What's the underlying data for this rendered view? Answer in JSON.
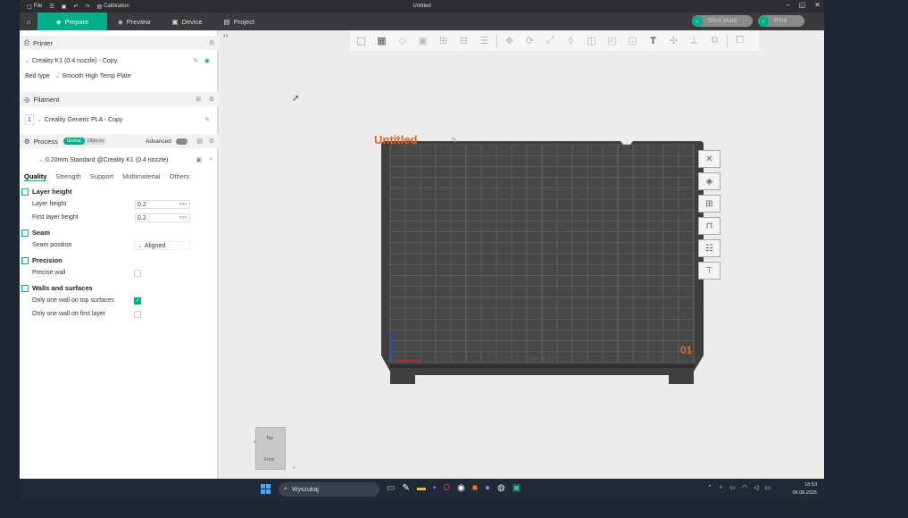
{
  "window": {
    "title": "Untitled",
    "menu": {
      "file": "File",
      "calibration": "Calibration"
    }
  },
  "tabs": [
    {
      "label": "Prepare"
    },
    {
      "label": "Preview"
    },
    {
      "label": "Device"
    },
    {
      "label": "Project"
    }
  ],
  "actions": {
    "slice": "Slice plate",
    "print": "Print"
  },
  "printer": {
    "header": "Printer",
    "selected": "Creality K1 (0.4 nozzle) - Copy",
    "bed_type_label": "Bed type",
    "bed_type_value": "Smooth High Temp Plate"
  },
  "filament": {
    "header": "Filament",
    "index": "1",
    "selected": "Creality Generic PLA - Copy"
  },
  "process": {
    "header": "Process",
    "toggle_global": "Global",
    "toggle_objects": "Objects",
    "advanced_label": "Advanced",
    "preset": "0.20mm Standard @Creality K1 (0.4 nozzle)",
    "subtabs": [
      "Quality",
      "Strength",
      "Support",
      "Multimaterial",
      "Others"
    ]
  },
  "settings": {
    "layer_height_group": "Layer height",
    "layer_height_label": "Layer height",
    "layer_height_value": "0.2",
    "first_layer_label": "First layer height",
    "first_layer_value": "0.2",
    "unit": "mm",
    "seam_group": "Seam",
    "seam_position_label": "Seam position",
    "seam_position_value": "Aligned",
    "precision_group": "Precision",
    "precise_wall_label": "Precise wall",
    "walls_group": "Walls and surfaces",
    "one_wall_top_label": "Only one wall on top surfaces",
    "one_wall_first_label": "Only one wall on first layer"
  },
  "canvas": {
    "plate_name": "Untitled",
    "plate_number": "01",
    "brand_mark": "CREALITY",
    "viewcube_top": "Top",
    "viewcube_front": "Front",
    "axis_x": "x",
    "axis_z": "z"
  },
  "taskbar": {
    "search_placeholder": "Wyszukaj",
    "time": "18:53",
    "date": "06.08.2025"
  },
  "colors": {
    "accent": "#00ae8c",
    "plate_label": "#e8622c"
  }
}
